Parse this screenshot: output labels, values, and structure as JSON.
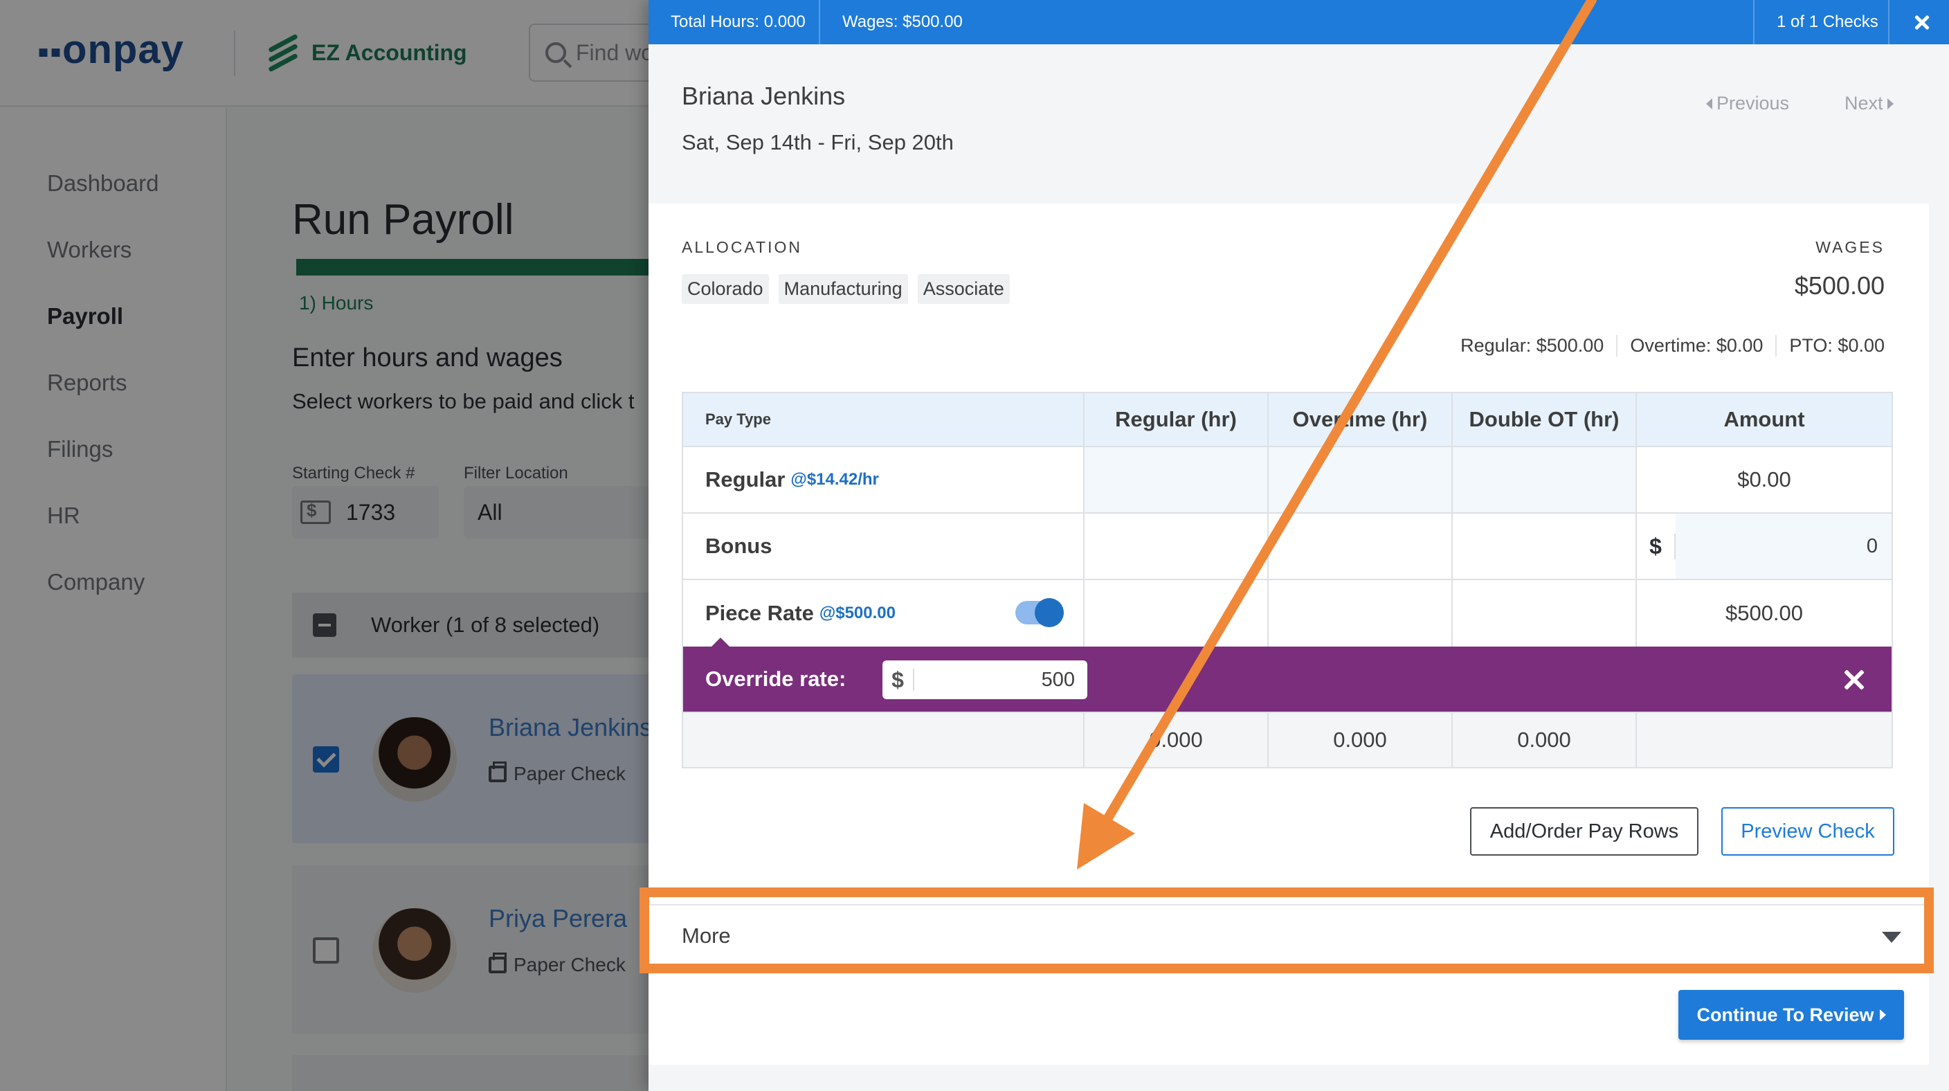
{
  "header": {
    "brand": "onpay",
    "brand_dots": "▪▪",
    "partner": "EZ Accounting",
    "search_placeholder": "Find wo"
  },
  "sidebar": {
    "items": [
      {
        "label": "Dashboard"
      },
      {
        "label": "Workers"
      },
      {
        "label": "Payroll",
        "active": true
      },
      {
        "label": "Reports"
      },
      {
        "label": "Filings"
      },
      {
        "label": "HR"
      },
      {
        "label": "Company"
      }
    ]
  },
  "main": {
    "title": "Run Payroll",
    "step": "1) Hours",
    "section_title": "Enter hours and wages",
    "section_sub": "Select workers to be paid and click t",
    "starting_check_label": "Starting Check #",
    "starting_check_value": "1733",
    "filter_location_label": "Filter Location",
    "filter_location_value": "All",
    "worker_header": "Worker (1 of 8 selected)",
    "workers": [
      {
        "name": "Briana Jenkins",
        "pay_method": "Paper Check",
        "selected": true
      },
      {
        "name": "Priya Perera",
        "pay_method": "Paper Check",
        "selected": false
      }
    ]
  },
  "panel": {
    "top": {
      "total_hours": "Total Hours: 0.000",
      "wages": "Wages: $500.00",
      "check_count": "1 of 1 Checks"
    },
    "employee_name": "Briana Jenkins",
    "date_range": "Sat, Sep 14th - Fri, Sep 20th",
    "previous": "Previous",
    "next": "Next",
    "allocation_label": "ALLOCATION",
    "allocations": [
      "Colorado",
      "Manufacturing",
      "Associate"
    ],
    "wages_label": "WAGES",
    "wages_total": "$500.00",
    "regular": "Regular: $500.00",
    "overtime": "Overtime: $0.00",
    "pto": "PTO: $0.00",
    "table": {
      "headers": [
        "Pay Type",
        "Regular (hr)",
        "Overtime (hr)",
        "Double OT (hr)",
        "Amount"
      ],
      "rows": [
        {
          "label": "Regular",
          "rate": "@$14.42/hr",
          "amount": "$0.00"
        },
        {
          "label": "Bonus",
          "currency": "$",
          "amount": "0"
        },
        {
          "label": "Piece Rate",
          "rate": "@$500.00",
          "amount": "$500.00"
        }
      ],
      "override_label": "Override rate:",
      "override_currency": "$",
      "override_value": "500",
      "totals": [
        "0.000",
        "0.000",
        "0.000"
      ]
    },
    "add_order_button": "Add/Order Pay Rows",
    "preview_button": "Preview Check",
    "more_label": "More",
    "continue_button": "Continue To Review"
  },
  "colors": {
    "brand_blue": "#1e7bd9",
    "override_purple": "#7a2e7c",
    "annotation_orange": "#f0883a",
    "accent_green": "#1f7a55"
  }
}
